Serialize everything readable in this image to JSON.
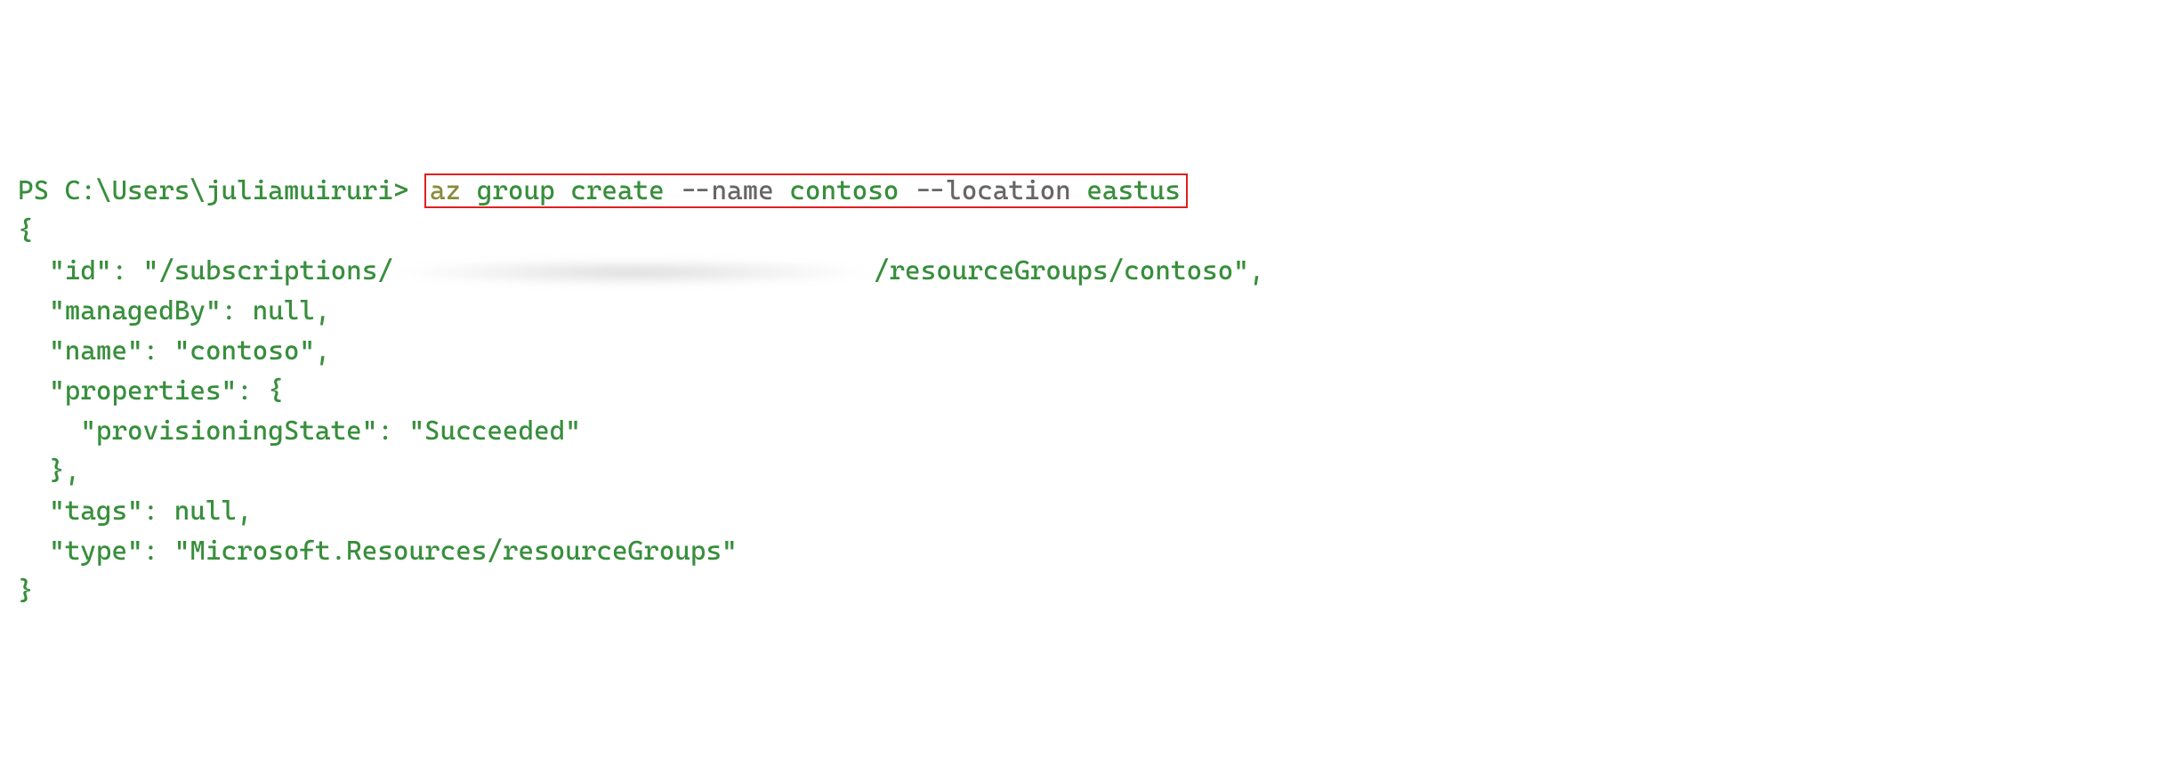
{
  "prompt": "PS C:\\Users\\juliamuiruri> ",
  "command": {
    "az": "az",
    "sub": "group create",
    "flag_name": "--name",
    "val_name": "contoso",
    "flag_loc": "--location",
    "val_loc": "eastus"
  },
  "output": {
    "open": "{",
    "id_key": "  \"id\": \"/subscriptions/",
    "id_tail": "/resourceGroups/contoso\",",
    "managedBy": "  \"managedBy\": null,",
    "name": "  \"name\": \"contoso\",",
    "props_open": "  \"properties\": {",
    "provState": "    \"provisioningState\": \"Succeeded\"",
    "props_close": "  },",
    "tags": "  \"tags\": null,",
    "type": "  \"type\": \"Microsoft.Resources/resourceGroups\"",
    "close": "}"
  }
}
